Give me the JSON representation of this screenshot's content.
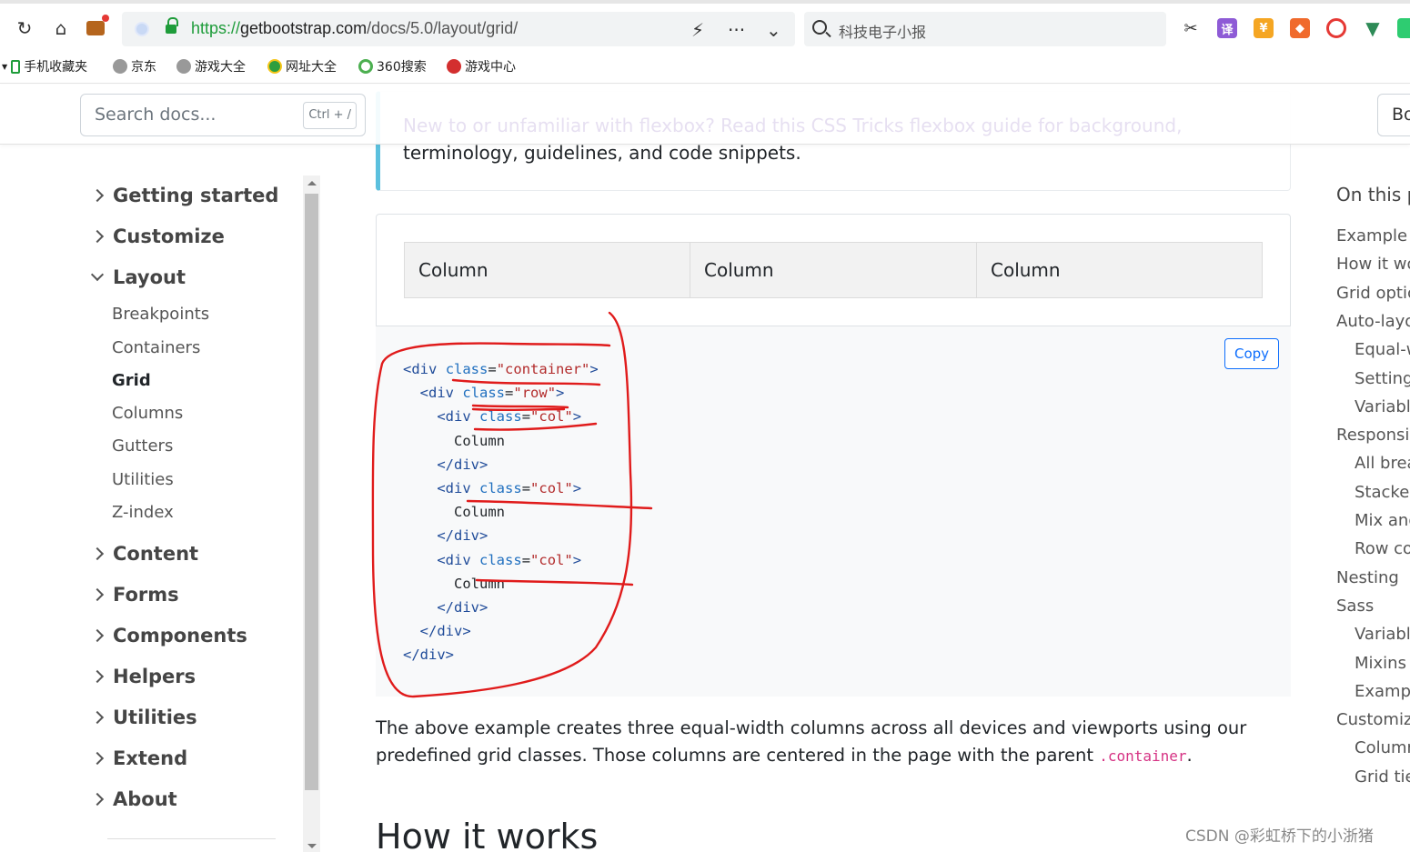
{
  "browser": {
    "url_scheme": "https://",
    "url_host": "getbootstrap.com",
    "url_path": "/docs/5.0/layout/grid/",
    "search_text": "科技电子小报",
    "bookmarks": [
      "手机收藏夹",
      "京东",
      "游戏大全",
      "网址大全",
      "360搜索",
      "游戏中心"
    ],
    "more_label": "···"
  },
  "header": {
    "search_placeholder": "Search docs...",
    "search_shortcut": "Ctrl + /",
    "right_button": "Bo",
    "faded_text": "New to or unfamiliar with flexbox? Read this CSS Tricks flexbox guide for background,"
  },
  "sidebar": {
    "groups": [
      {
        "label": "Getting started"
      },
      {
        "label": "Customize"
      },
      {
        "label": "Layout"
      },
      {
        "label": "Content"
      },
      {
        "label": "Forms"
      },
      {
        "label": "Components"
      },
      {
        "label": "Helpers"
      },
      {
        "label": "Utilities"
      },
      {
        "label": "Extend"
      },
      {
        "label": "About"
      }
    ],
    "layout_items": [
      "Breakpoints",
      "Containers",
      "Grid",
      "Columns",
      "Gutters",
      "Utilities",
      "Z-index"
    ],
    "active_item": "Grid"
  },
  "main": {
    "callout_text": "terminology, guidelines, and code snippets.",
    "columns": [
      "Column",
      "Column",
      "Column"
    ],
    "copy_label": "Copy",
    "code": {
      "l1_open": "<",
      "l1_tag": "div",
      "l1_attr": "class",
      "l1_val": "\"container\"",
      "l1_close": ">",
      "l2_tag": "div",
      "l2_attr": "class",
      "l2_val": "\"row\"",
      "col_tag": "div",
      "col_attr": "class",
      "col_val": "\"col\"",
      "column_text": "Column",
      "end_div": "div"
    },
    "paragraph_pre": "The above example creates three equal-width columns across all devices and viewports using our predefined grid classes. Those columns are centered in the page with the parent ",
    "paragraph_code": ".container",
    "paragraph_post": ".",
    "heading": "How it works"
  },
  "toc": {
    "title": "On this p",
    "items": [
      {
        "label": "Example",
        "level": 1
      },
      {
        "label": "How it wo",
        "level": 1
      },
      {
        "label": "Grid optic",
        "level": 1
      },
      {
        "label": "Auto-layo",
        "level": 1
      },
      {
        "label": "Equal-w",
        "level": 2
      },
      {
        "label": "Setting",
        "level": 2
      },
      {
        "label": "Variable",
        "level": 2
      },
      {
        "label": "Responsiv",
        "level": 1
      },
      {
        "label": "All brea",
        "level": 2
      },
      {
        "label": "Stacked",
        "level": 2
      },
      {
        "label": "Mix and",
        "level": 2
      },
      {
        "label": "Row co",
        "level": 2
      },
      {
        "label": "Nesting",
        "level": 1
      },
      {
        "label": "Sass",
        "level": 1
      },
      {
        "label": "Variable",
        "level": 2
      },
      {
        "label": "Mixins",
        "level": 2
      },
      {
        "label": "Exampl",
        "level": 2
      },
      {
        "label": "Customizi",
        "level": 1
      },
      {
        "label": "Column",
        "level": 2
      },
      {
        "label": "Grid tie",
        "level": 2
      }
    ]
  },
  "watermark": "CSDN @彩虹桥下的小浙猪",
  "colors": {
    "annotation": "#e01b1b",
    "link_primary": "#0d6efd",
    "callout_border": "#5bc0de"
  }
}
